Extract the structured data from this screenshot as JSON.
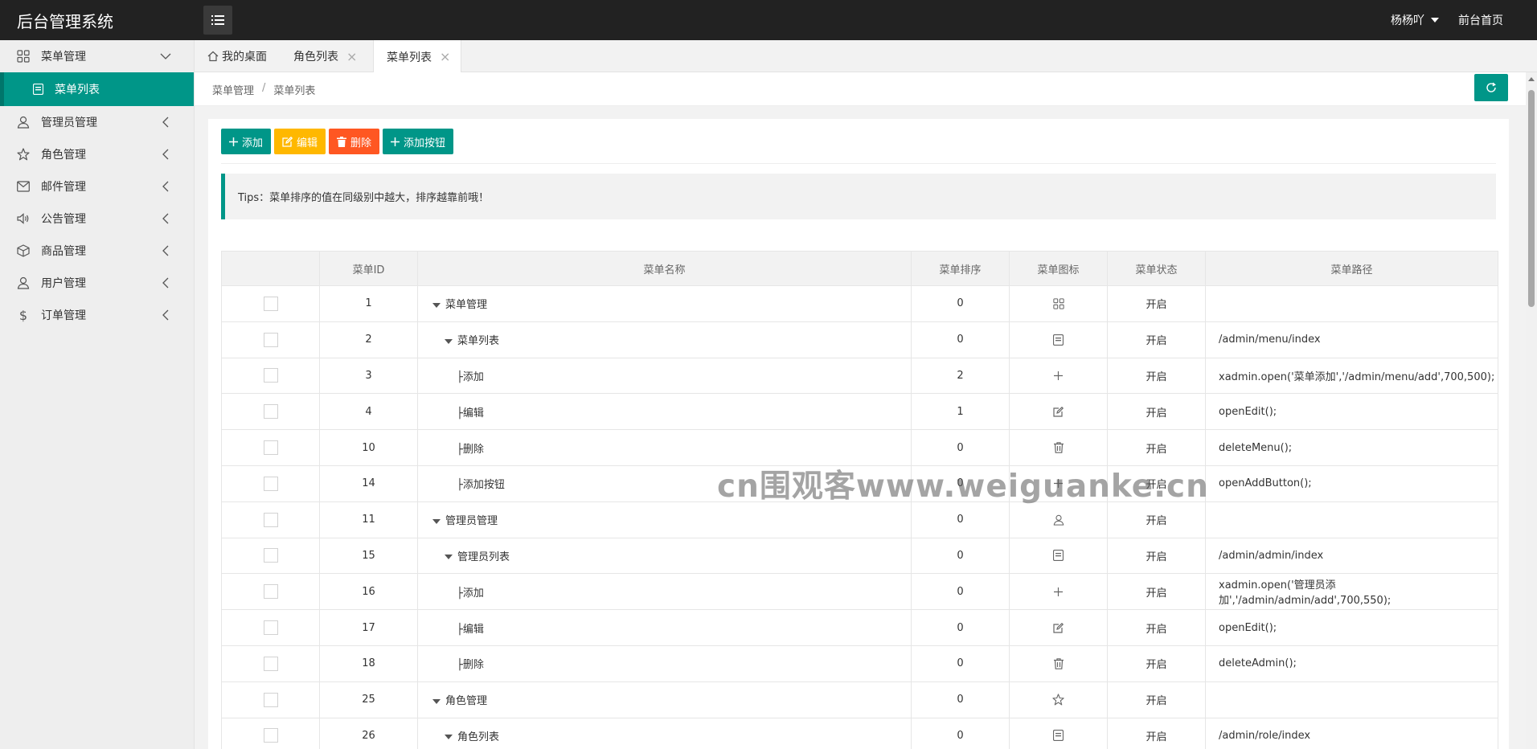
{
  "app": {
    "title": "后台管理系统",
    "user": "杨杨吖",
    "home_link": "前台首页"
  },
  "sidebar": {
    "items": [
      {
        "label": "菜单管理",
        "icon": "grid-icon",
        "expanded": true,
        "children": [
          {
            "label": "菜单列表",
            "icon": "document-icon"
          }
        ]
      },
      {
        "label": "管理员管理",
        "icon": "user-icon"
      },
      {
        "label": "角色管理",
        "icon": "star-icon"
      },
      {
        "label": "邮件管理",
        "icon": "mail-icon"
      },
      {
        "label": "公告管理",
        "icon": "speaker-icon"
      },
      {
        "label": "商品管理",
        "icon": "box-icon"
      },
      {
        "label": "用户管理",
        "icon": "user-icon"
      },
      {
        "label": "订单管理",
        "icon": "dollar-icon"
      }
    ]
  },
  "tabs": [
    {
      "label": "我的桌面",
      "closable": false
    },
    {
      "label": "角色列表",
      "closable": true
    },
    {
      "label": "菜单列表",
      "closable": true,
      "active": true
    }
  ],
  "breadcrumb": [
    "菜单管理",
    "菜单列表"
  ],
  "toolbar": {
    "add": "添加",
    "edit": "编辑",
    "delete": "删除",
    "add_button": "添加按钮"
  },
  "tips": "Tips：菜单排序的值在同级别中越大，排序越靠前哦！",
  "watermark": "cn围观客www.weiguanke.cn",
  "table": {
    "headers": [
      "菜单ID",
      "菜单名称",
      "菜单排序",
      "菜单图标",
      "菜单状态",
      "菜单路径"
    ],
    "rows": [
      {
        "id": "1",
        "name": "菜单管理",
        "level": 0,
        "order": "0",
        "icon": "grid-icon",
        "status": "开启",
        "path": ""
      },
      {
        "id": "2",
        "name": "菜单列表",
        "level": 1,
        "order": "0",
        "icon": "document-icon",
        "status": "开启",
        "path": "/admin/menu/index"
      },
      {
        "id": "3",
        "name": "添加",
        "level": 2,
        "order": "2",
        "icon": "plus-icon",
        "status": "开启",
        "path": "xadmin.open('菜单添加','/admin/menu/add',700,500);"
      },
      {
        "id": "4",
        "name": "编辑",
        "level": 2,
        "order": "1",
        "icon": "edit-icon",
        "status": "开启",
        "path": "openEdit();"
      },
      {
        "id": "10",
        "name": "删除",
        "level": 2,
        "order": "0",
        "icon": "trash-icon",
        "status": "开启",
        "path": "deleteMenu();"
      },
      {
        "id": "14",
        "name": "添加按钮",
        "level": 2,
        "order": "0",
        "icon": "plus-icon",
        "status": "开启",
        "path": "openAddButton();"
      },
      {
        "id": "11",
        "name": "管理员管理",
        "level": 0,
        "order": "0",
        "icon": "user-icon",
        "status": "开启",
        "path": ""
      },
      {
        "id": "15",
        "name": "管理员列表",
        "level": 1,
        "order": "0",
        "icon": "document-icon",
        "status": "开启",
        "path": "/admin/admin/index"
      },
      {
        "id": "16",
        "name": "添加",
        "level": 2,
        "order": "0",
        "icon": "plus-icon",
        "status": "开启",
        "path": "xadmin.open('管理员添加','/admin/admin/add',700,550);"
      },
      {
        "id": "17",
        "name": "编辑",
        "level": 2,
        "order": "0",
        "icon": "edit-icon",
        "status": "开启",
        "path": "openEdit();"
      },
      {
        "id": "18",
        "name": "删除",
        "level": 2,
        "order": "0",
        "icon": "trash-icon",
        "status": "开启",
        "path": "deleteAdmin();"
      },
      {
        "id": "25",
        "name": "角色管理",
        "level": 0,
        "order": "0",
        "icon": "star-icon",
        "status": "开启",
        "path": ""
      },
      {
        "id": "26",
        "name": "角色列表",
        "level": 1,
        "order": "0",
        "icon": "document-icon",
        "status": "开启",
        "path": "/admin/role/index"
      }
    ]
  },
  "colors": {
    "primary": "#009688",
    "warning": "#FFB800",
    "danger": "#FF5722",
    "header": "#222222"
  }
}
